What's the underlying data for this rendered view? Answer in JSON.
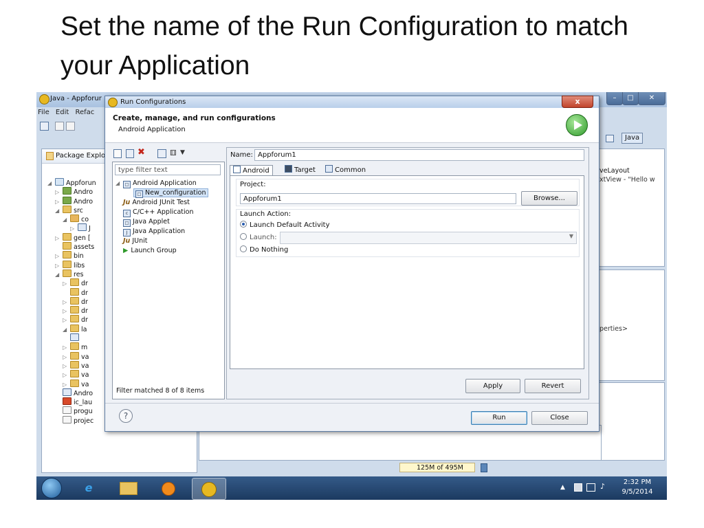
{
  "slide": {
    "title": "Set the name of the Run Configuration to match your Application"
  },
  "ide": {
    "title": "Java - Appforur",
    "menu": [
      "File",
      "Edit",
      "Refac"
    ],
    "package_explorer_label": "Package Explo",
    "perspective_label": "Java",
    "tree": [
      "Appforun",
      "Andro",
      "Andro",
      "src",
      "co",
      "J",
      "gen [",
      "assets",
      "bin",
      "libs",
      "res",
      "dr",
      "dr",
      "dr",
      "dr",
      "dr",
      "la",
      "m",
      "va",
      "va",
      "va",
      "va",
      "Andro",
      "ic_lau",
      "progu",
      "projec"
    ],
    "right_hint_1": "veLayout",
    "right_hint_2": "xtView - \"Hello w",
    "properties_hint": "perties>",
    "memory": "125M of 495M"
  },
  "dialog": {
    "title": "Run Configurations",
    "heading": "Create, manage, and run configurations",
    "subheading": "Android Application",
    "filter_placeholder": "type filter text",
    "config_tree": [
      {
        "label": "Android Application",
        "icon": "android-app-icon"
      },
      {
        "label": "New_configuration",
        "icon": "config-icon"
      },
      {
        "label": "Android JUnit Test",
        "icon": "junit-icon"
      },
      {
        "label": "C/C++ Application",
        "icon": "c-icon"
      },
      {
        "label": "Java Applet",
        "icon": "applet-icon"
      },
      {
        "label": "Java Application",
        "icon": "java-app-icon"
      },
      {
        "label": "JUnit",
        "icon": "junit-icon"
      },
      {
        "label": "Launch Group",
        "icon": "launch-group-icon"
      }
    ],
    "filter_status": "Filter matched 8 of 8 items",
    "name_label": "Name:",
    "name_value": "Appforum1",
    "tabs": [
      "Android",
      "Target",
      "Common"
    ],
    "project_label": "Project:",
    "project_value": "Appforum1",
    "browse_label": "Browse...",
    "launch_action_label": "Launch Action:",
    "launch_options": [
      "Launch Default Activity",
      "Launch:",
      "Do Nothing"
    ],
    "apply_label": "Apply",
    "revert_label": "Revert",
    "run_label": "Run",
    "close_label": "Close",
    "close_x": "x"
  },
  "taskbar": {
    "time": "2:32 PM",
    "date": "9/5/2014"
  }
}
